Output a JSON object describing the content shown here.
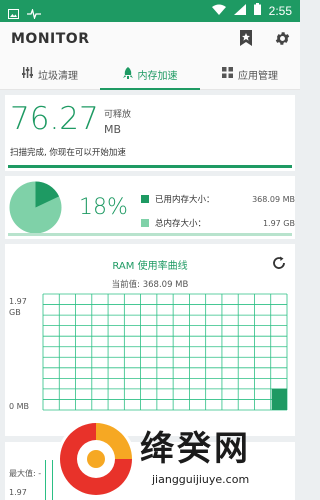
{
  "status_bar": {
    "time": "2:55",
    "icons": [
      "image-icon",
      "pulse-icon",
      "wifi-icon",
      "signal-icon",
      "battery-icon"
    ],
    "color": "#1e9a63"
  },
  "app_bar": {
    "title": "MONITOR",
    "actions": [
      "bookmark-star-icon",
      "gear-icon"
    ]
  },
  "tabs": [
    {
      "label": "垃圾清理",
      "icon": "sliders-icon",
      "active": false
    },
    {
      "label": "内存加速",
      "icon": "rocket-icon",
      "active": true
    },
    {
      "label": "应用管理",
      "icon": "grid-icon",
      "active": false
    }
  ],
  "release": {
    "value": "76.27",
    "label": "可释放",
    "unit": "MB",
    "message": "扫描完成, 你现在可以开始加速"
  },
  "memory": {
    "percent": "18%",
    "percent_value": 18,
    "used_label": "已用内存大小：",
    "used_value": "368.09 MB",
    "total_label": "总内存大小：",
    "total_value": "1.97 GB",
    "used_color": "#1e9a63",
    "total_color": "#7fd1a8"
  },
  "ram_chart": {
    "title": "RAM 使用率曲线",
    "current_label": "当前值:",
    "current_value": "368.09 MB",
    "y_max_label": "1.97\nGB",
    "y_min_label": "0 MB",
    "grid_color": "#2bbf84",
    "fill_color": "#1e9a63"
  },
  "chart_data": {
    "type": "area",
    "title": "RAM 使用率曲线",
    "ylabel": "",
    "ylim": [
      0,
      1.97
    ],
    "y_unit": "GB",
    "series": [
      {
        "values": [
          0.36
        ]
      }
    ]
  },
  "bottom_card": {
    "max_label": "最大值: -",
    "y_top": "1.97"
  },
  "watermark": {
    "text": "绛癸网",
    "url": "jiangguijiuye.com"
  }
}
